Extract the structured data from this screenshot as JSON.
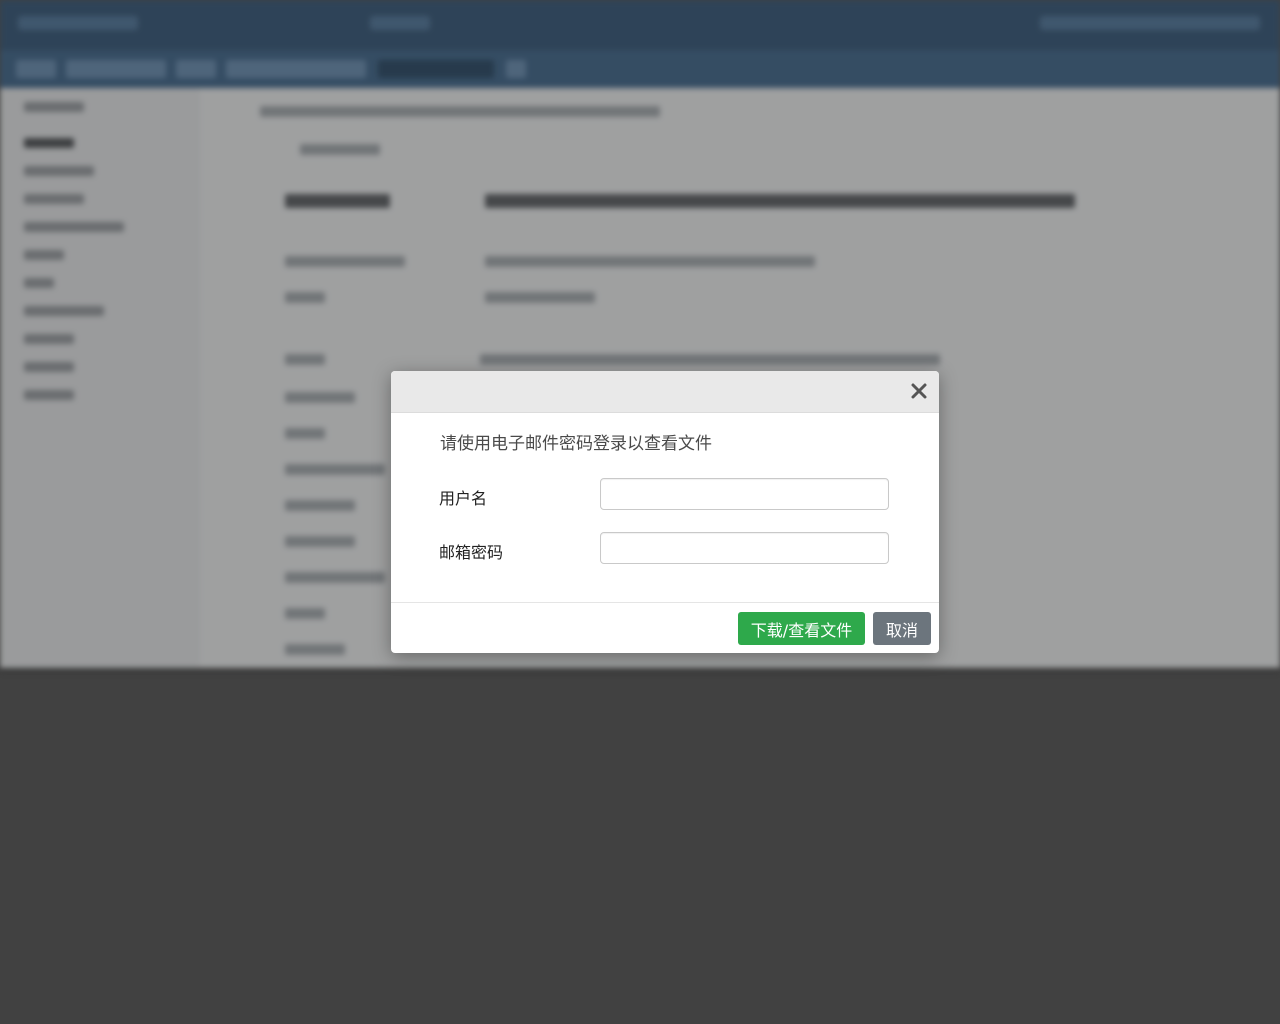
{
  "dialog": {
    "message": "请使用电子邮件密码登录以查看文件",
    "username_label": "用户名",
    "username_value": "",
    "password_label": "邮箱密码",
    "password_value": "",
    "submit_label": "下载/查看文件",
    "cancel_label": "取消",
    "close_icon": "close-icon"
  },
  "colors": {
    "overlay": "#414141",
    "header_bg": "#e9e9e9",
    "submit_bg": "#2ea94b",
    "cancel_bg": "#6c757d",
    "app_topbar": "#20466b"
  }
}
